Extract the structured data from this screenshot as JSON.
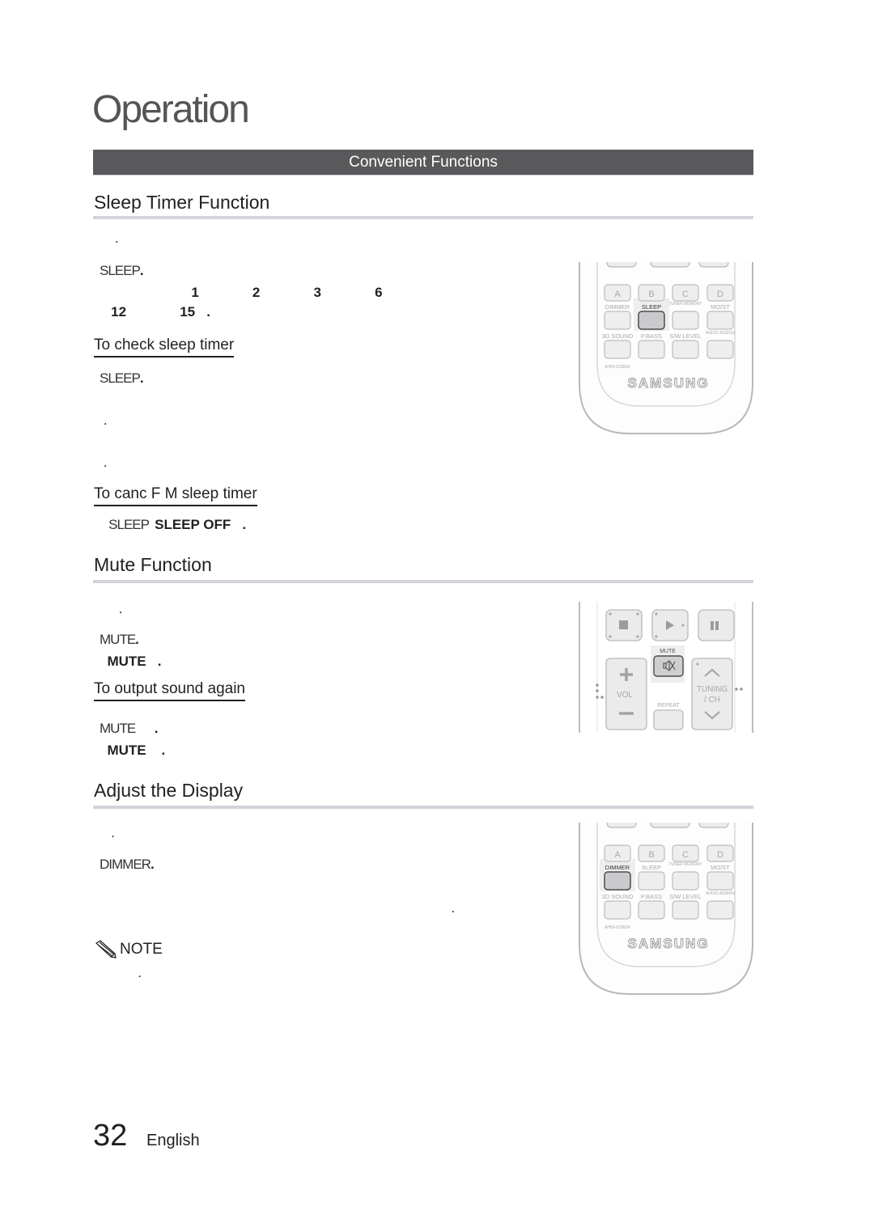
{
  "page": {
    "chapter_title": "Operation",
    "section_bar": "Convenient Functions",
    "footer": {
      "page_number": "32",
      "language": "English"
    }
  },
  "sleep_timer": {
    "heading": "Sleep Timer Function",
    "lines": [
      {
        "parts": [
          {
            "text": "    .",
            "style": "plain"
          }
        ]
      },
      {
        "parts": [
          {
            "text": "SLEEP",
            "style": "thin"
          },
          {
            "text": ".",
            "style": "bold"
          }
        ]
      },
      {
        "parts": [
          {
            "text": "                        1              2              3              6",
            "style": "bold"
          }
        ]
      },
      {
        "parts": [
          {
            "text": "   12              15   .",
            "style": "bold"
          }
        ]
      }
    ],
    "check_subheading": "To check sleep timer",
    "check_lines": [
      {
        "parts": [
          {
            "text": "SLEEP",
            "style": "thin"
          },
          {
            "text": ".",
            "style": "bold"
          }
        ]
      },
      {
        "parts": [
          {
            "text": " .",
            "style": "plain"
          }
        ]
      },
      {
        "parts": [
          {
            "text": " .",
            "style": "plain"
          }
        ]
      }
    ],
    "cancel_subheading": "To canc F M sleep timer",
    "cancel_line": {
      "parts": [
        {
          "text": "   SLEEP  ",
          "style": "thin"
        },
        {
          "text": "SLEEP OFF   .",
          "style": "bold"
        }
      ]
    }
  },
  "mute": {
    "heading": "Mute Function",
    "lines": [
      {
        "parts": [
          {
            "text": "     .",
            "style": "plain"
          }
        ]
      },
      {
        "parts": [
          {
            "text": "MUTE",
            "style": "thin"
          },
          {
            "text": ".",
            "style": "bold"
          }
        ]
      },
      {
        "parts": [
          {
            "text": "  MUTE   .",
            "style": "bold"
          }
        ]
      }
    ],
    "output_subheading": "To output sound again",
    "output_lines": [
      {
        "parts": [
          {
            "text": "MUTE",
            "style": "thin"
          },
          {
            "text": "     .",
            "style": "bold"
          }
        ]
      },
      {
        "parts": [
          {
            "text": "  MUTE    .",
            "style": "bold"
          }
        ]
      }
    ]
  },
  "display": {
    "heading": "Adjust the Display",
    "lines": [
      {
        "parts": [
          {
            "text": "   .",
            "style": "plain"
          }
        ]
      },
      {
        "parts": [
          {
            "text": "DIMMER",
            "style": "thin"
          },
          {
            "text": ".",
            "style": "bold"
          }
        ]
      },
      {
        "parts": [
          {
            "text": "                                                                                            .",
            "style": "plain"
          }
        ]
      }
    ],
    "note_label": "NOTE",
    "note_lines": [
      {
        "parts": [
          {
            "text": "          .",
            "style": "plain"
          }
        ]
      }
    ]
  },
  "remote_grid": {
    "letters": [
      "A",
      "B",
      "C",
      "D"
    ],
    "row1_labels": [
      "DIMMER",
      "SLEEP",
      "TUNER MEMORY",
      "MO/ST"
    ],
    "row2_labels": [
      "3D SOUND",
      "P.BASS",
      "S/W LEVEL",
      "AUDIO ASSIGN"
    ],
    "model_code": "AH59-02382A",
    "brand": "SAMSUNG"
  },
  "remote_sleep": {
    "highlighted": "SLEEP"
  },
  "remote_display": {
    "highlighted": "DIMMER"
  },
  "remote_mute": {
    "mute_label": "MUTE",
    "vol_label": "VOL",
    "tuning_label": "TUNING",
    "ch_label": "/ CH",
    "repeat_label": "REPEAT",
    "stop_icon": "stop-icon",
    "play_icon": "play-icon",
    "pause_icon": "pause-icon",
    "mute_icon": "speaker-mute-icon"
  }
}
